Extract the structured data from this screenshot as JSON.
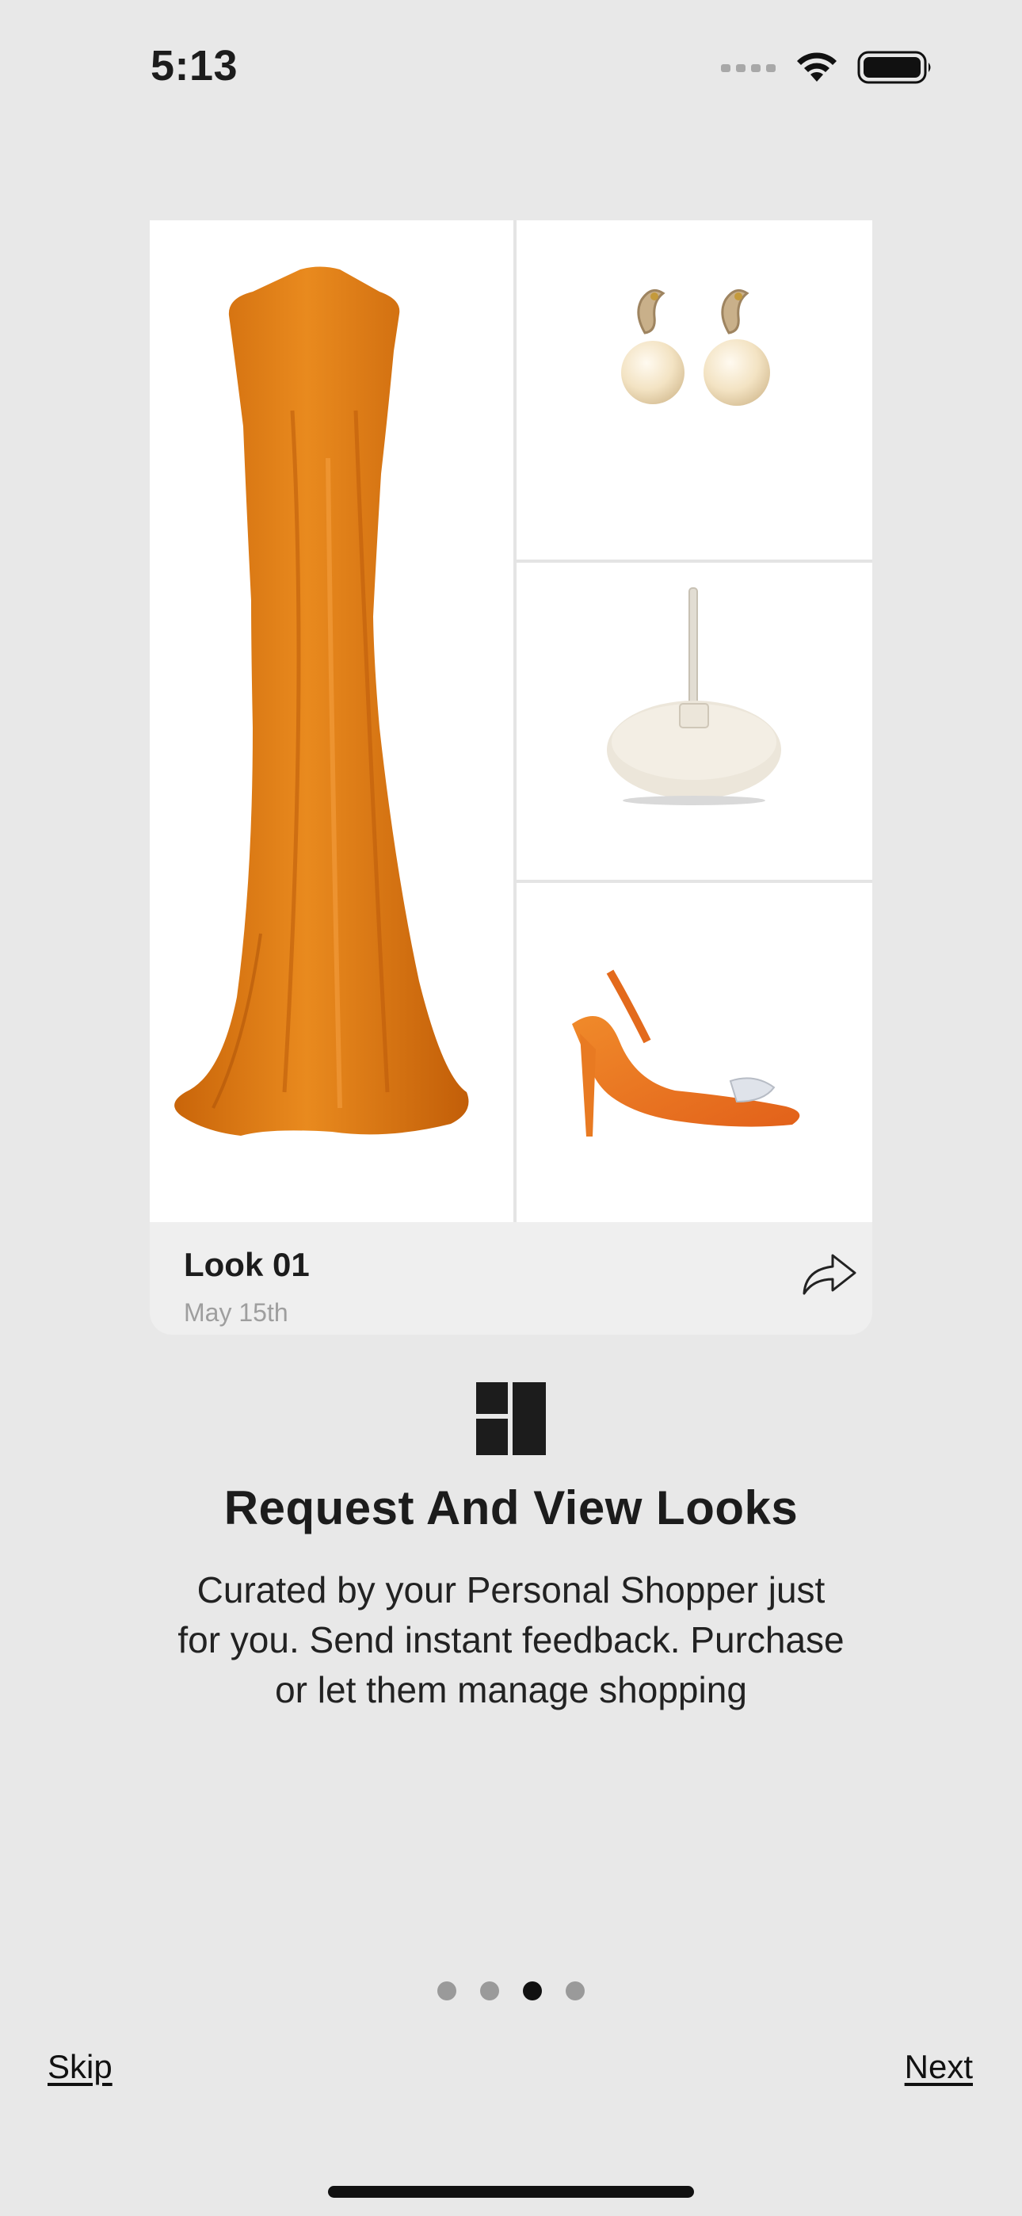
{
  "status_bar": {
    "time": "5:13",
    "icons": [
      "cellular-signal-icon",
      "wifi-icon",
      "battery-icon"
    ]
  },
  "look_card": {
    "title": "Look 01",
    "date": "May 15th",
    "items": [
      "dress",
      "earrings",
      "bag",
      "shoe"
    ],
    "share_icon": "share-arrow-icon"
  },
  "intro": {
    "icon": "grid-layout-icon",
    "heading": "Request And View Looks",
    "description": "Curated by your Personal Shopper just for you. Send instant feedback. Purchase or let them manage shopping"
  },
  "pager": {
    "total_pages": 4,
    "active_page": 3
  },
  "nav": {
    "skip_label": "Skip",
    "next_label": "Next"
  },
  "colors": {
    "background": "#e8e8e8",
    "dress": "#e07810",
    "dot_inactive": "#9a9a9a",
    "dot_active": "#111111"
  }
}
